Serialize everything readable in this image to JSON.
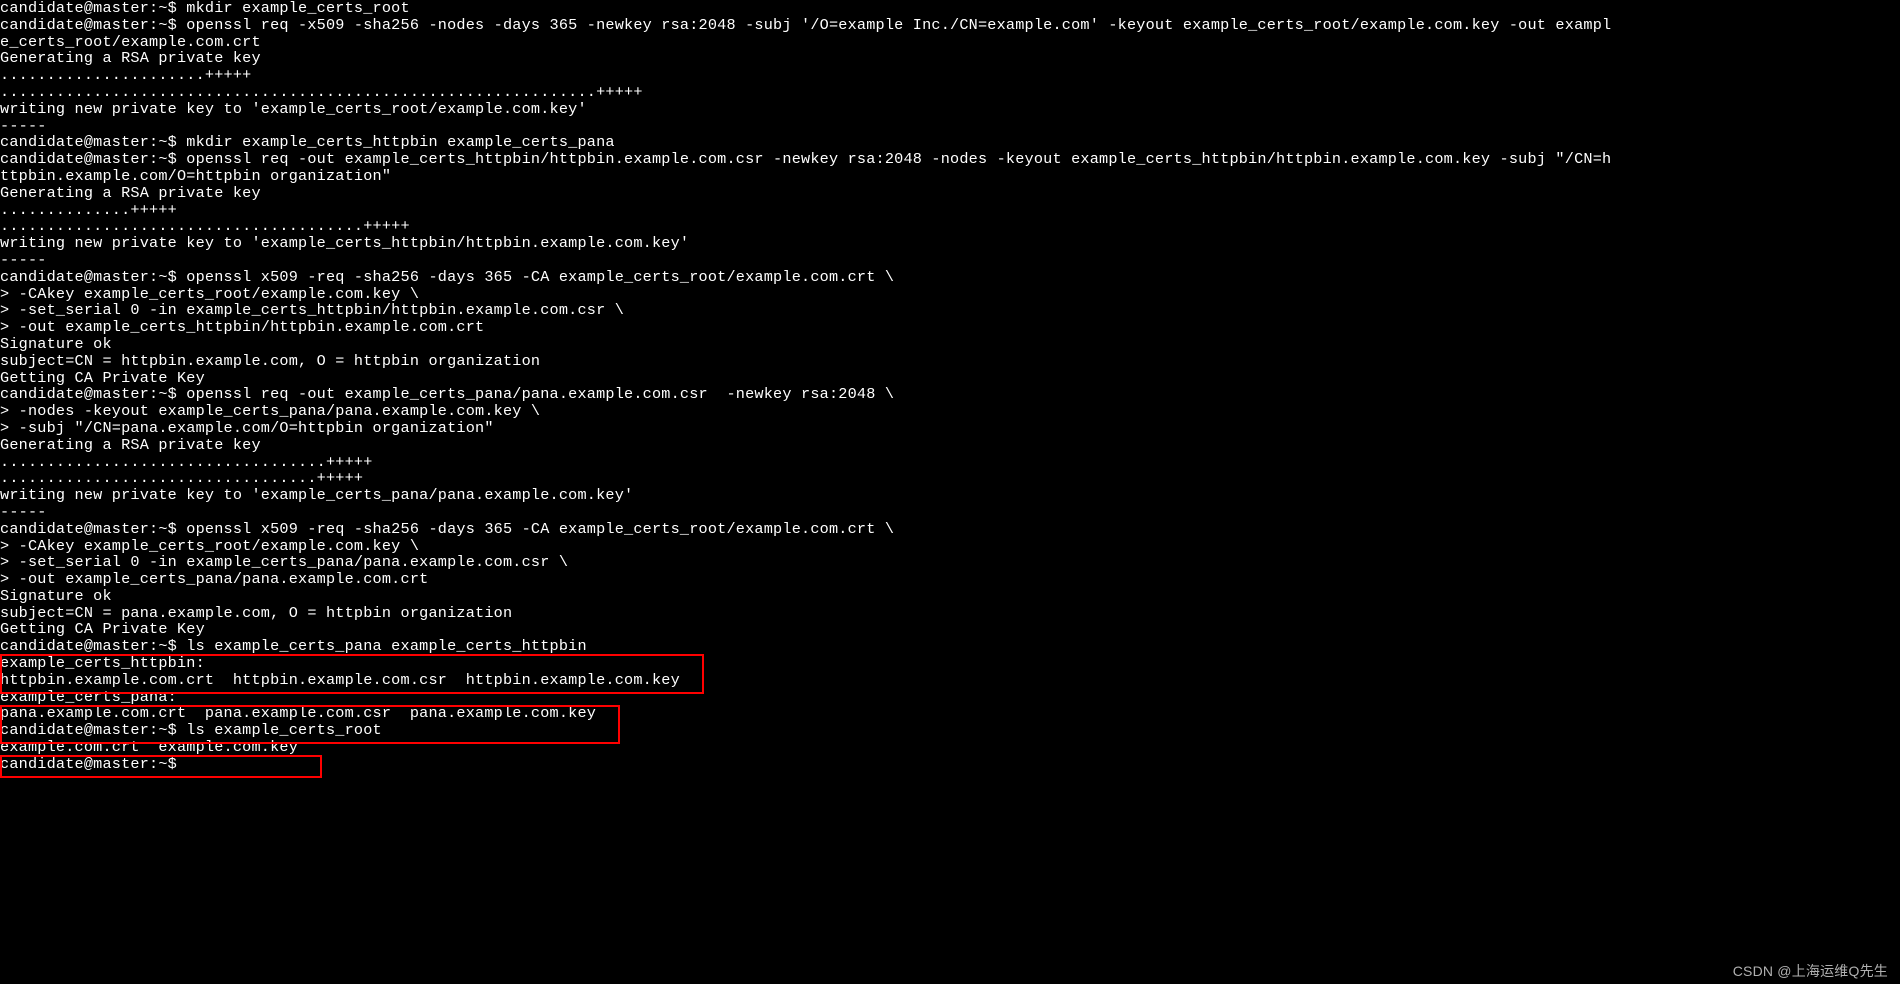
{
  "terminal": {
    "lines": [
      "candidate@master:~$ mkdir example_certs_root",
      "candidate@master:~$ openssl req -x509 -sha256 -nodes -days 365 -newkey rsa:2048 -subj '/O=example Inc./CN=example.com' -keyout example_certs_root/example.com.key -out example_certs_root/example.com.crt",
      "Generating a RSA private key",
      "......................+++++",
      "................................................................+++++",
      "writing new private key to 'example_certs_root/example.com.key'",
      "-----",
      "candidate@master:~$ mkdir example_certs_httpbin example_certs_pana",
      "candidate@master:~$ openssl req -out example_certs_httpbin/httpbin.example.com.csr -newkey rsa:2048 -nodes -keyout example_certs_httpbin/httpbin.example.com.key -subj \"/CN=httpbin.example.com/O=httpbin organization\"",
      "Generating a RSA private key",
      "..............+++++",
      ".......................................+++++",
      "writing new private key to 'example_certs_httpbin/httpbin.example.com.key'",
      "-----",
      "candidate@master:~$ openssl x509 -req -sha256 -days 365 -CA example_certs_root/example.com.crt \\",
      "> -CAkey example_certs_root/example.com.key \\",
      "> -set_serial 0 -in example_certs_httpbin/httpbin.example.com.csr \\",
      "> -out example_certs_httpbin/httpbin.example.com.crt",
      "Signature ok",
      "subject=CN = httpbin.example.com, O = httpbin organization",
      "Getting CA Private Key",
      "candidate@master:~$ openssl req -out example_certs_pana/pana.example.com.csr  -newkey rsa:2048 \\",
      "> -nodes -keyout example_certs_pana/pana.example.com.key \\",
      "> -subj \"/CN=pana.example.com/O=httpbin organization\"",
      "Generating a RSA private key",
      "...................................+++++",
      "..................................+++++",
      "writing new private key to 'example_certs_pana/pana.example.com.key'",
      "-----",
      "candidate@master:~$ openssl x509 -req -sha256 -days 365 -CA example_certs_root/example.com.crt \\",
      "> -CAkey example_certs_root/example.com.key \\",
      "> -set_serial 0 -in example_certs_pana/pana.example.com.csr \\",
      "> -out example_certs_pana/pana.example.com.crt",
      "Signature ok",
      "subject=CN = pana.example.com, O = httpbin organization",
      "Getting CA Private Key",
      "candidate@master:~$ ls example_certs_pana example_certs_httpbin",
      "example_certs_httpbin:",
      "httpbin.example.com.crt  httpbin.example.com.csr  httpbin.example.com.key",
      "",
      "example_certs_pana:",
      "pana.example.com.crt  pana.example.com.csr  pana.example.com.key",
      "candidate@master:~$ ls example_certs_root",
      "example.com.crt  example.com.key",
      "candidate@master:~$ "
    ]
  },
  "highlights": [
    {
      "line_from": 37,
      "line_to": 38
    },
    {
      "line_from": 40,
      "line_to": 41
    },
    {
      "line_from": 43,
      "line_to": 43
    }
  ],
  "watermark": "CSDN @上海运维Q先生"
}
